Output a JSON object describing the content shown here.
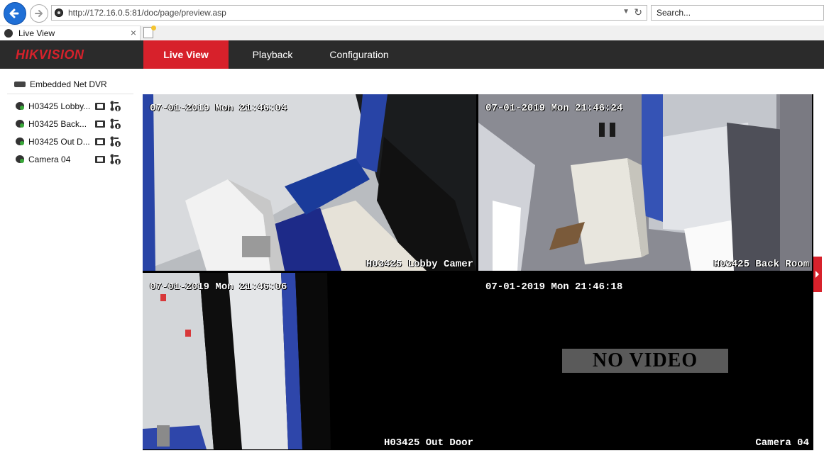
{
  "browser": {
    "url": "http://172.16.0.5:81/doc/page/preview.asp",
    "search_placeholder": "Search...",
    "tab_title": "Live View"
  },
  "app": {
    "logo": "HIKVISION",
    "nav": [
      "Live View",
      "Playback",
      "Configuration"
    ],
    "active_nav": "Live View",
    "accent_color": "#d7212b"
  },
  "sidebar": {
    "device": "Embedded Net DVR",
    "cameras": [
      {
        "label": "H03425 Lobby..."
      },
      {
        "label": "H03425 Back..."
      },
      {
        "label": "H03425 Out D..."
      },
      {
        "label": "Camera 04"
      }
    ]
  },
  "video": {
    "tiles": [
      {
        "timestamp": "07-01-2019 Mon 21:46:04",
        "name": "H03425 Lobby Camer",
        "selected": true
      },
      {
        "timestamp": "07-01-2019 Mon 21:46:24",
        "name": "H03425 Back Room"
      },
      {
        "timestamp": "07-01-2019 Mon 21:46:06",
        "name": "H03425 Out Door"
      },
      {
        "timestamp": "07-01-2019 Mon 21:46:18",
        "name": "Camera 04",
        "status": "NO VIDEO"
      }
    ]
  }
}
